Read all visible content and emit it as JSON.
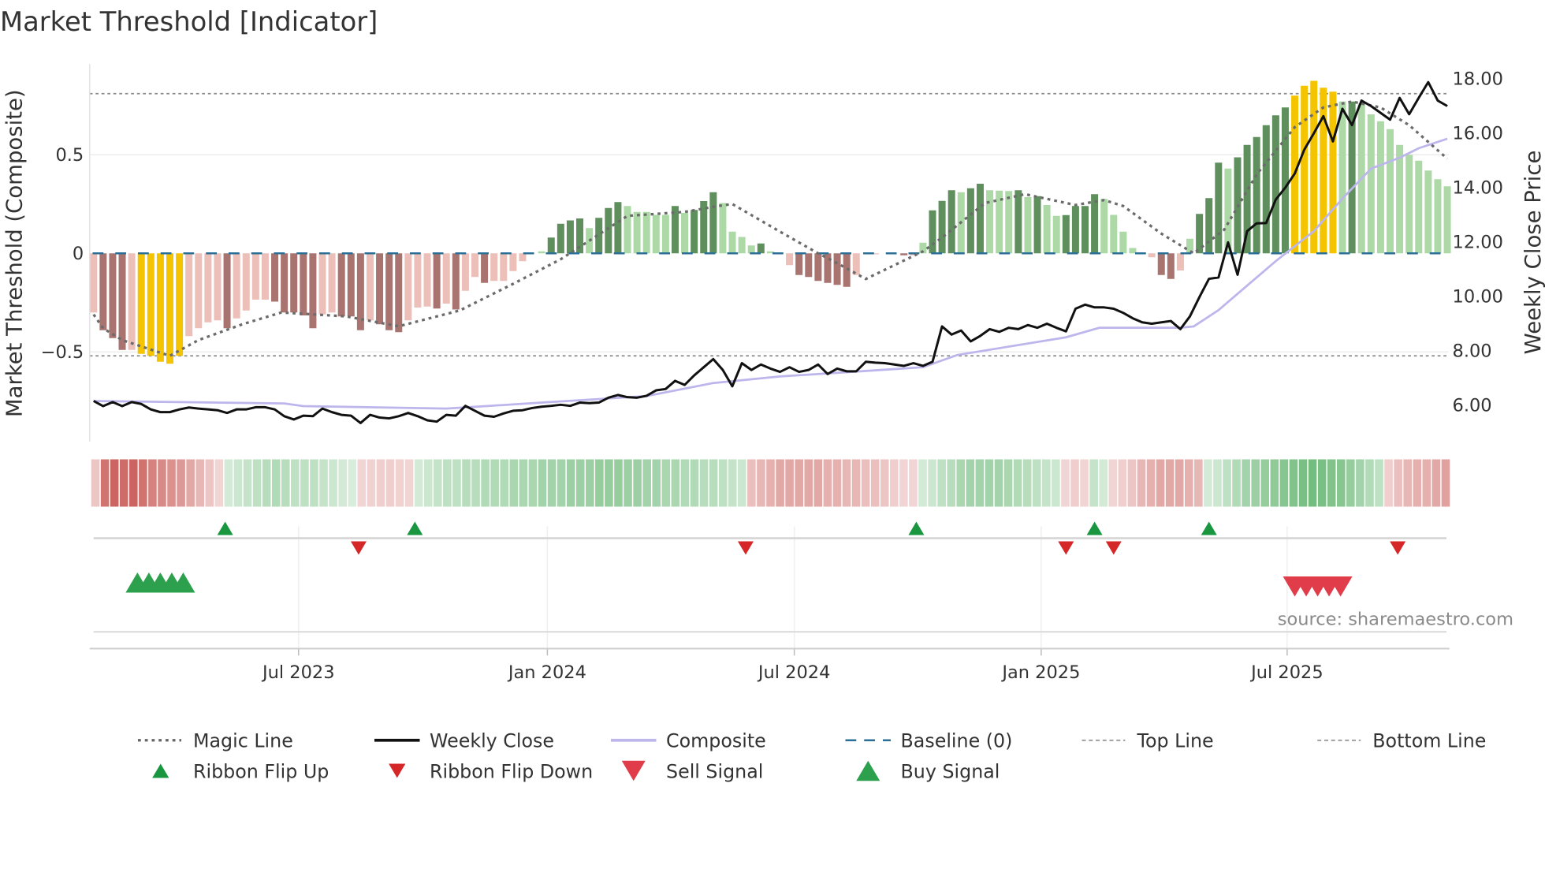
{
  "chart_data": {
    "type": "bar",
    "title": "Market Threshold [Indicator]",
    "ylabel_left": "Market Threshold (Composite)",
    "ylabel_right": "Weekly Close Price",
    "ylim_left": [
      -0.95,
      0.96
    ],
    "ylim_right": [
      4.9,
      18.55
    ],
    "left_ticks": [
      {
        "v": 0.5,
        "label": "0.5"
      },
      {
        "v": 0,
        "label": "0"
      },
      {
        "v": -0.5,
        "label": "−0.5"
      }
    ],
    "right_ticks": [
      {
        "v": 18,
        "label": "18.00"
      },
      {
        "v": 16,
        "label": "16.00"
      },
      {
        "v": 14,
        "label": "14.00"
      },
      {
        "v": 12,
        "label": "12.00"
      },
      {
        "v": 10,
        "label": "10.00"
      },
      {
        "v": 8,
        "label": "8.00"
      },
      {
        "v": 6,
        "label": "6.00"
      }
    ],
    "x_ticks": [
      {
        "week": 21.5,
        "label": "Jul 2023"
      },
      {
        "week": 47.6,
        "label": "Jan 2024"
      },
      {
        "week": 73.5,
        "label": "Jul 2024"
      },
      {
        "week": 99.4,
        "label": "Jan 2025"
      },
      {
        "week": 125.2,
        "label": "Jul 2025"
      }
    ],
    "top_line": 0.81,
    "bottom_line": -0.52,
    "baseline": 0,
    "bar_values": [
      -0.3,
      -0.39,
      -0.43,
      -0.49,
      -0.49,
      -0.51,
      -0.52,
      -0.55,
      -0.56,
      -0.52,
      -0.42,
      -0.38,
      -0.35,
      -0.34,
      -0.38,
      -0.33,
      -0.29,
      -0.235,
      -0.235,
      -0.245,
      -0.3,
      -0.3,
      -0.315,
      -0.38,
      -0.31,
      -0.3,
      -0.32,
      -0.32,
      -0.39,
      -0.34,
      -0.36,
      -0.39,
      -0.4,
      -0.34,
      -0.275,
      -0.27,
      -0.28,
      -0.255,
      -0.285,
      -0.19,
      -0.12,
      -0.15,
      -0.14,
      -0.14,
      -0.09,
      -0.04,
      0,
      0.01,
      0.08,
      0.15,
      0.167,
      0.177,
      0.128,
      0.18,
      0.23,
      0.26,
      0.24,
      0.21,
      0.21,
      0.195,
      0.195,
      0.24,
      0.205,
      0.22,
      0.265,
      0.31,
      0.255,
      0.11,
      0.083,
      0.04,
      0.05,
      0.01,
      0,
      -0.06,
      -0.11,
      -0.12,
      -0.14,
      -0.15,
      -0.16,
      -0.17,
      -0.11,
      0,
      -0.005,
      0,
      0,
      -0.01,
      -0.01,
      0.054,
      0.218,
      0.266,
      0.32,
      0.31,
      0.33,
      0.353,
      0.32,
      0.318,
      0.316,
      0.32,
      0.285,
      0.29,
      0.245,
      0.19,
      0.194,
      0.24,
      0.24,
      0.3,
      0.276,
      0.195,
      0.11,
      0.027,
      0.005,
      -0.02,
      -0.11,
      -0.13,
      -0.087,
      0.074,
      0.2,
      0.28,
      0.46,
      0.43,
      0.487,
      0.55,
      0.59,
      0.65,
      0.7,
      0.74,
      0.8,
      0.85,
      0.875,
      0.84,
      0.82,
      0.77,
      0.77,
      0.76,
      0.705,
      0.67,
      0.63,
      0.55,
      0.5,
      0.47,
      0.42,
      0.376,
      0.34
    ],
    "bar_states": [
      "lr",
      "dr",
      "dr",
      "dr",
      "lr",
      "y",
      "y",
      "y",
      "y",
      "y",
      "lr",
      "lr",
      "lr",
      "lr",
      "dr",
      "lr",
      "lr",
      "lr",
      "lr",
      "dr",
      "dr",
      "dr",
      "dr",
      "dr",
      "lr",
      "lr",
      "dr",
      "dr",
      "dr",
      "lr",
      "dr",
      "dr",
      "dr",
      "lr",
      "lr",
      "lr",
      "dr",
      "lr",
      "dr",
      "lr",
      "lr",
      "dr",
      "lr",
      "lr",
      "lr",
      "lr",
      "lg",
      "lg",
      "dg",
      "dg",
      "dg",
      "dg",
      "lg",
      "dg",
      "dg",
      "dg",
      "lg",
      "lg",
      "lg",
      "lg",
      "lg",
      "dg",
      "lg",
      "dg",
      "dg",
      "dg",
      "lg",
      "lg",
      "lg",
      "lg",
      "dg",
      "lg",
      "lg",
      "lr",
      "dr",
      "dr",
      "dr",
      "dr",
      "dr",
      "dr",
      "lr",
      "lg",
      "lr",
      "lg",
      "lg",
      "dr",
      "lr",
      "lg",
      "dg",
      "dg",
      "dg",
      "lg",
      "dg",
      "dg",
      "lg",
      "lg",
      "lg",
      "dg",
      "lg",
      "dg",
      "lg",
      "lg",
      "dg",
      "dg",
      "dg",
      "dg",
      "lg",
      "lg",
      "lg",
      "lg",
      "lg",
      "lr",
      "dr",
      "dr",
      "lr",
      "lg",
      "dg",
      "dg",
      "dg",
      "lg",
      "dg",
      "dg",
      "dg",
      "dg",
      "dg",
      "dg",
      "y",
      "y",
      "y",
      "y",
      "y",
      "lg",
      "dg",
      "lg",
      "lg",
      "lg",
      "lg",
      "lg",
      "lg",
      "lg",
      "lg",
      "lg",
      "lg"
    ],
    "bar_colors": {
      "dr": "#a97470",
      "lr": "#ecbfb9",
      "y": "#f5c400",
      "dg": "#5f8f5c",
      "lg": "#acd9a6"
    },
    "magic_line": [
      [
        0,
        -0.31
      ],
      [
        1,
        -0.38
      ],
      [
        3,
        -0.44
      ],
      [
        8,
        -0.52
      ],
      [
        11,
        -0.44
      ],
      [
        15.6,
        -0.36
      ],
      [
        19.7,
        -0.3
      ],
      [
        26.5,
        -0.32
      ],
      [
        32,
        -0.37
      ],
      [
        38.4,
        -0.29
      ],
      [
        44,
        -0.155
      ],
      [
        49,
        -0.03
      ],
      [
        52.5,
        0.08
      ],
      [
        56,
        0.19
      ],
      [
        62,
        0.21
      ],
      [
        65.5,
        0.24
      ],
      [
        67,
        0.25
      ],
      [
        72,
        0.11
      ],
      [
        76,
        0
      ],
      [
        78,
        -0.05
      ],
      [
        81,
        -0.13
      ],
      [
        87,
        0.01
      ],
      [
        89,
        0.08
      ],
      [
        93.5,
        0.255
      ],
      [
        97.7,
        0.3
      ],
      [
        103,
        0.245
      ],
      [
        106,
        0.27
      ],
      [
        108,
        0.24
      ],
      [
        112,
        0.1
      ],
      [
        115.4,
        0.0
      ],
      [
        118.6,
        0.12
      ],
      [
        122,
        0.4
      ],
      [
        126,
        0.64
      ],
      [
        129,
        0.74
      ],
      [
        132,
        0.77
      ],
      [
        135,
        0.74
      ],
      [
        138,
        0.65
      ],
      [
        142,
        0.48
      ]
    ],
    "weekly_close": [
      6.16,
      5.97,
      6.12,
      5.97,
      6.12,
      6.05,
      5.85,
      5.75,
      5.75,
      5.85,
      5.92,
      5.88,
      5.85,
      5.82,
      5.72,
      5.85,
      5.85,
      5.93,
      5.93,
      5.85,
      5.6,
      5.48,
      5.62,
      5.6,
      5.88,
      5.75,
      5.65,
      5.62,
      5.35,
      5.65,
      5.55,
      5.52,
      5.6,
      5.72,
      5.6,
      5.45,
      5.4,
      5.65,
      5.62,
      5.98,
      5.8,
      5.62,
      5.58,
      5.7,
      5.8,
      5.82,
      5.9,
      5.95,
      5.98,
      6.02,
      5.98,
      6.1,
      6.08,
      6.1,
      6.28,
      6.38,
      6.3,
      6.28,
      6.35,
      6.55,
      6.6,
      6.9,
      6.75,
      7.1,
      7.4,
      7.7,
      7.3,
      6.7,
      7.55,
      7.3,
      7.5,
      7.35,
      7.23,
      7.4,
      7.23,
      7.3,
      7.5,
      7.15,
      7.35,
      7.25,
      7.25,
      7.6,
      7.57,
      7.55,
      7.5,
      7.45,
      7.55,
      7.45,
      7.6,
      8.9,
      8.6,
      8.75,
      8.35,
      8.55,
      8.8,
      8.7,
      8.85,
      8.8,
      8.95,
      8.85,
      9.0,
      8.85,
      8.72,
      9.55,
      9.7,
      9.6,
      9.6,
      9.55,
      9.4,
      9.2,
      9.05,
      9.0,
      9.05,
      9.1,
      8.8,
      9.27,
      9.98,
      10.65,
      10.7,
      11.99,
      10.8,
      12.4,
      12.69,
      12.7,
      13.56,
      14.0,
      14.52,
      15.4,
      16.0,
      16.63,
      15.7,
      16.9,
      16.3,
      17.2,
      17.0,
      16.75,
      16.5,
      17.3,
      16.7,
      17.3,
      17.88,
      17.2,
      17.0
    ],
    "composite_price": [
      [
        0,
        6.16
      ],
      [
        20,
        6.07
      ],
      [
        22,
        5.97
      ],
      [
        37,
        5.88
      ],
      [
        47,
        6.1
      ],
      [
        58,
        6.34
      ],
      [
        65,
        6.82
      ],
      [
        72,
        7.06
      ],
      [
        87,
        7.4
      ],
      [
        90.6,
        7.85
      ],
      [
        102,
        8.5
      ],
      [
        105.5,
        8.85
      ],
      [
        114,
        8.85
      ],
      [
        115.4,
        8.9
      ],
      [
        118,
        9.5
      ],
      [
        121,
        10.4
      ],
      [
        124,
        11.3
      ],
      [
        128,
        12.4
      ],
      [
        131,
        13.6
      ],
      [
        134,
        14.7
      ],
      [
        137,
        15.1
      ],
      [
        139,
        15.45
      ],
      [
        142,
        15.8
      ]
    ],
    "ribbon": [
      -0.2,
      -0.75,
      -0.85,
      -0.8,
      -0.85,
      -0.75,
      -0.65,
      -0.6,
      -0.55,
      -0.5,
      -0.4,
      -0.3,
      -0.2,
      -0.1,
      0.15,
      0.2,
      0.25,
      0.3,
      0.35,
      0.4,
      0.35,
      0.3,
      0.3,
      0.3,
      0.25,
      0.2,
      0.15,
      0.1,
      -0.1,
      -0.12,
      -0.15,
      -0.15,
      -0.12,
      -0.1,
      0.15,
      0.2,
      0.25,
      0.3,
      0.3,
      0.35,
      0.35,
      0.4,
      0.4,
      0.4,
      0.45,
      0.45,
      0.45,
      0.5,
      0.5,
      0.5,
      0.55,
      0.55,
      0.55,
      0.6,
      0.6,
      0.6,
      0.55,
      0.55,
      0.5,
      0.5,
      0.45,
      0.45,
      0.4,
      0.4,
      0.35,
      0.35,
      0.3,
      0.25,
      0.2,
      -0.25,
      -0.3,
      -0.35,
      -0.4,
      -0.4,
      -0.4,
      -0.4,
      -0.4,
      -0.35,
      -0.35,
      -0.3,
      -0.3,
      -0.25,
      -0.25,
      -0.2,
      -0.15,
      -0.1,
      -0.1,
      0.15,
      0.2,
      0.3,
      0.35,
      0.45,
      0.5,
      0.5,
      0.5,
      0.5,
      0.45,
      0.4,
      0.35,
      0.3,
      0.25,
      0.2,
      -0.1,
      -0.15,
      -0.1,
      0.25,
      0.15,
      -0.1,
      -0.15,
      -0.2,
      -0.3,
      -0.35,
      -0.4,
      -0.4,
      -0.4,
      -0.35,
      -0.3,
      0.15,
      0.2,
      0.3,
      0.4,
      0.5,
      0.55,
      0.6,
      0.65,
      0.7,
      0.75,
      0.8,
      0.85,
      0.8,
      0.75,
      0.7,
      0.6,
      0.5,
      0.4,
      0.3,
      -0.15,
      -0.25,
      -0.3,
      -0.35,
      -0.35,
      -0.4,
      -0.45
    ],
    "ribbon_flip_up": [
      13.8,
      33.7,
      86.3,
      105,
      117
    ],
    "ribbon_flip_down": [
      27.8,
      68.4,
      102,
      107,
      136.8
    ],
    "buy_signals": [
      4.6,
      5.8,
      7,
      8.2,
      9.4
    ],
    "sell_signals": [
      126,
      127.2,
      128.4,
      129.6,
      130.8
    ],
    "source": "source: sharemaestro.com",
    "legend": [
      {
        "label": "Magic Line",
        "kind": "dotted",
        "color": "#666666"
      },
      {
        "label": "Weekly Close",
        "kind": "solid",
        "color": "#111111"
      },
      {
        "label": "Composite",
        "kind": "solid-light",
        "color": "#bdb6ec"
      },
      {
        "label": "Baseline (0)",
        "kind": "dashed",
        "color": "#2a6f97"
      },
      {
        "label": "Top Line",
        "kind": "thin-dashed",
        "color": "#999999"
      },
      {
        "label": "Bottom Line",
        "kind": "thin-dashed",
        "color": "#999999"
      },
      {
        "label": "Ribbon Flip Up",
        "kind": "tri-up",
        "color": "#1a9641"
      },
      {
        "label": "Ribbon Flip Down",
        "kind": "tri-down",
        "color": "#d62728"
      },
      {
        "label": "Sell Signal",
        "kind": "tri-down-big",
        "color": "#e03c4a"
      },
      {
        "label": "Buy Signal",
        "kind": "tri-up-big",
        "color": "#2ca04c"
      }
    ]
  }
}
